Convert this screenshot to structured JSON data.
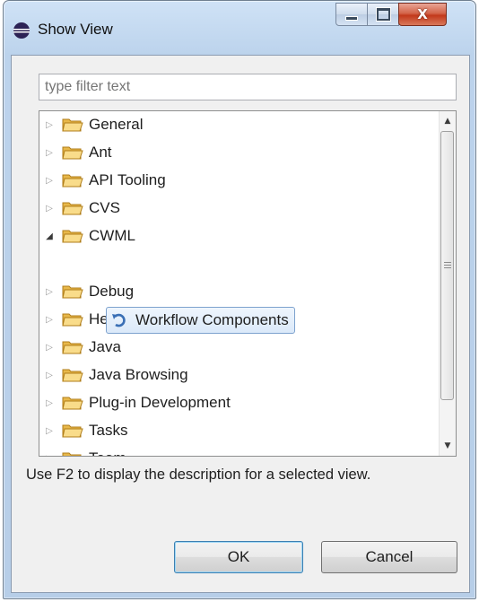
{
  "window": {
    "title": "Show View",
    "close_glyph": "X"
  },
  "filter": {
    "placeholder": "type filter text",
    "value": ""
  },
  "tree": {
    "items": [
      {
        "label": "General",
        "expanded": false
      },
      {
        "label": "Ant",
        "expanded": false
      },
      {
        "label": "API Tooling",
        "expanded": false
      },
      {
        "label": "CVS",
        "expanded": false
      },
      {
        "label": "CWML",
        "expanded": true
      },
      {
        "label": "Debug",
        "expanded": false
      },
      {
        "label": "Help",
        "expanded": false
      },
      {
        "label": "Java",
        "expanded": false
      },
      {
        "label": "Java Browsing",
        "expanded": false
      },
      {
        "label": "Plug-in Development",
        "expanded": false
      },
      {
        "label": "Tasks",
        "expanded": false
      },
      {
        "label": "Team",
        "expanded": false
      }
    ],
    "selected_child": {
      "label": "Workflow Components",
      "parent": "CWML",
      "icon": "workflow-icon"
    }
  },
  "description": "Use F2 to display the description for a selected view.",
  "buttons": {
    "ok_label": "OK",
    "cancel_label": "Cancel"
  },
  "icons": {
    "app": "eclipse-icon",
    "folder": "folder-icon",
    "collapsed": "expand-triangle-icon",
    "expanded": "collapse-triangle-icon"
  },
  "colors": {
    "title_bar": "#bcd3ec",
    "close_button": "#c2391b",
    "selection_border": "#7da2ce",
    "default_button_border": "#3c7fb1"
  }
}
